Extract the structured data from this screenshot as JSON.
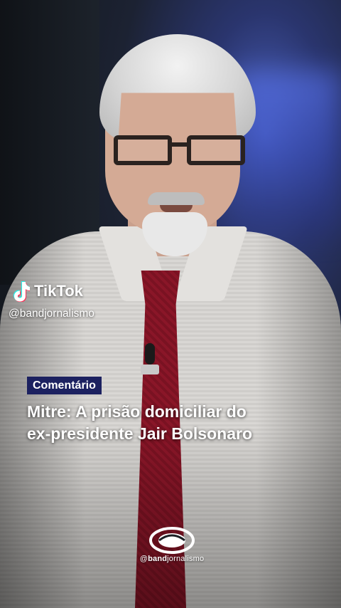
{
  "watermark": {
    "app_name": "TikTok",
    "icon": "tiktok-note-icon",
    "handle": "@bandjornalismo"
  },
  "caption": {
    "badge": "Comentário",
    "headline_line1": "Mitre: A prisão domiciliar do",
    "headline_line2": "ex-presidente Jair Bolsonaro"
  },
  "logo": {
    "prefix": "@",
    "bold": "band",
    "rest": "jornalismo",
    "icon": "band-eye-logo-icon"
  },
  "colors": {
    "badge_bg": "#1c2160",
    "tie": "#8a1628",
    "backdrop_accent": "#4a5fb8"
  }
}
